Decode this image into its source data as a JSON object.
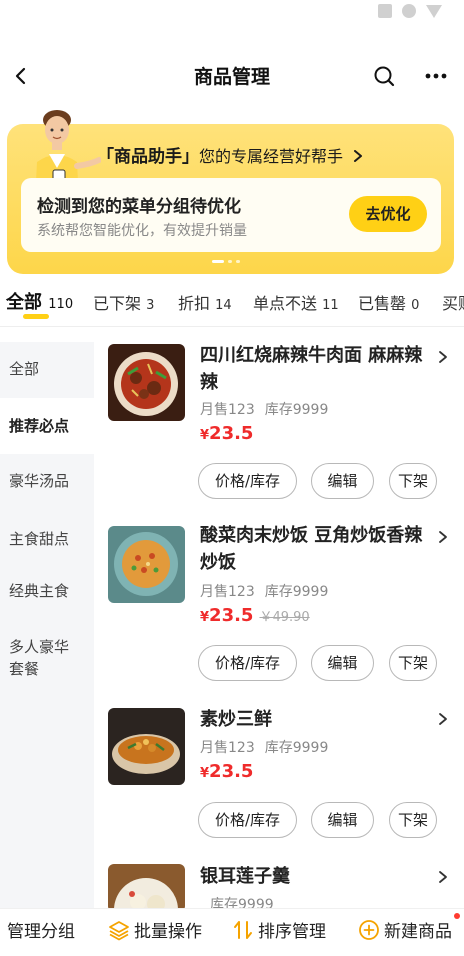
{
  "nav": {
    "title": "商品管理"
  },
  "banner": {
    "headline": "「商品助手」",
    "headline_sub": "您的专属经营好帮手",
    "title": "检测到您的菜单分组待优化",
    "subtitle": "系统帮您智能优化，有效提升销量",
    "button": "去优化"
  },
  "tabs": [
    {
      "label": "全部",
      "count": "110"
    },
    {
      "label": "已下架",
      "count": "3"
    },
    {
      "label": "折扣",
      "count": "14"
    },
    {
      "label": "单点不送",
      "count": "11"
    },
    {
      "label": "已售罄",
      "count": "0"
    },
    {
      "label": "买赠",
      "count": ""
    }
  ],
  "sidebar": {
    "items": [
      {
        "label": "全部"
      },
      {
        "label": "推荐必点"
      },
      {
        "label": "豪华汤品"
      },
      {
        "label": "主食甜点"
      },
      {
        "label": "经典主食"
      },
      {
        "label": "多人豪华套餐"
      }
    ]
  },
  "products": [
    {
      "name": "四川红烧麻辣牛肉面 麻麻辣辣",
      "sales": "月售123",
      "stock": "库存9999",
      "price": "23.5",
      "yen": "¥",
      "orig_price": ""
    },
    {
      "name": "酸菜肉末炒饭 豆角炒饭香辣炒饭",
      "sales": "月售123",
      "stock": "库存9999",
      "price": "23.5",
      "yen": "¥",
      "orig_price": "￥49.90"
    },
    {
      "name": "素炒三鲜",
      "sales": "月售123",
      "stock": "库存9999",
      "price": "23.5",
      "yen": "¥",
      "orig_price": ""
    },
    {
      "name": "银耳莲子羹",
      "sales": "",
      "stock": "库存9999",
      "price": "",
      "yen": "",
      "orig_price": ""
    }
  ],
  "product_buttons": {
    "price_stock": "价格/库存",
    "edit": "编辑",
    "off_shelf": "下架"
  },
  "bottom_bar": {
    "manage_groups": "管理分组",
    "batch": "批量操作",
    "sort": "排序管理",
    "add": "新建商品"
  },
  "colors": {
    "accent": "#ffd015",
    "price": "#ef2b2b",
    "badge": "#ff3b30"
  }
}
